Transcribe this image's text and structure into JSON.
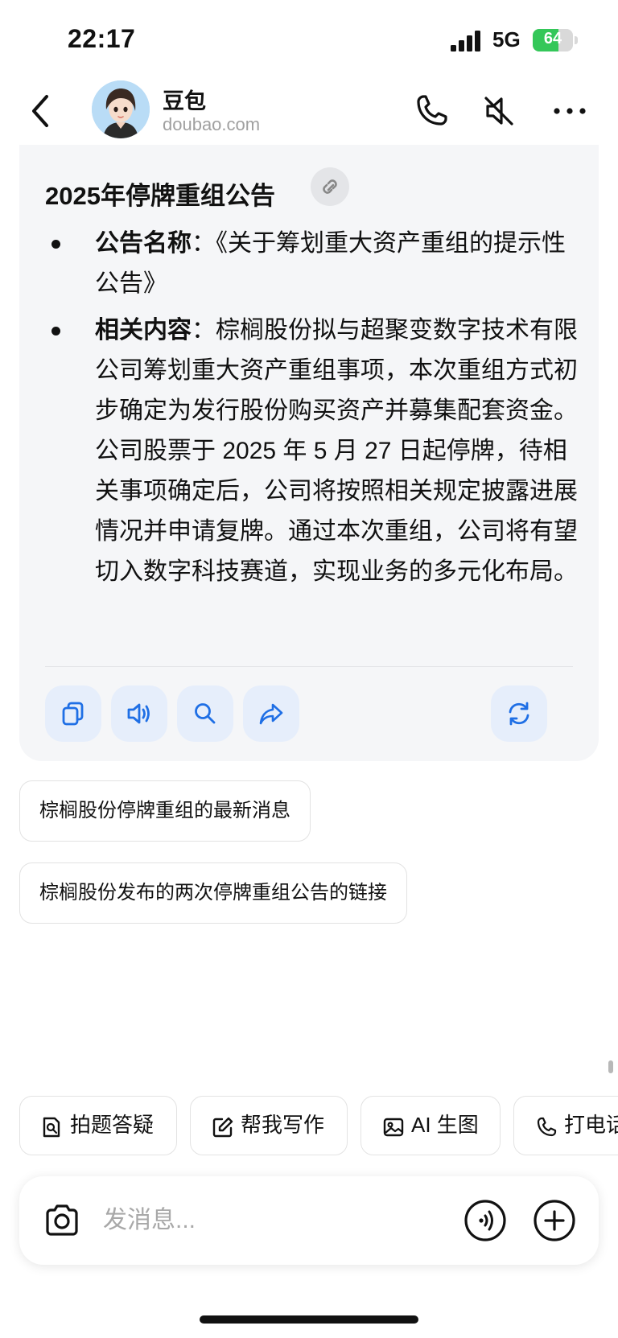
{
  "status_bar": {
    "time": "22:17",
    "network": "5G",
    "battery": "64",
    "battery_level": 0.64
  },
  "header": {
    "name": "豆包",
    "domain": "doubao.com"
  },
  "card": {
    "title": "2025年停牌重组公告",
    "items": [
      {
        "label": "公告名称",
        "separator": "：",
        "text": "《关于筹划重大资产重组的提示性公告》"
      },
      {
        "label": "相关内容",
        "separator": "：",
        "text": "棕榈股份拟与超聚变数字技术有限公司筹划重大资产重组事项，本次重组方式初步确定为发行股份购买资产并募集配套资金。公司股票于 2025 年 5 月 27 日起停牌，待相关事项确定后，公司将按照相关规定披露进展情况并申请复牌。通过本次重组，公司将有望切入数字科技赛道，实现业务的多元化布局。"
      }
    ]
  },
  "suggestions": [
    "棕榈股份停牌重组的最新消息",
    "棕榈股份发布的两次停牌重组公告的链接"
  ],
  "shortcuts": [
    {
      "label": "拍题答疑",
      "icon": "question-scan-icon"
    },
    {
      "label": "帮我写作",
      "icon": "edit-icon"
    },
    {
      "label": "AI 生图",
      "icon": "image-icon"
    },
    {
      "label": "打电话",
      "icon": "phone-icon"
    }
  ],
  "composer": {
    "placeholder": "发消息..."
  },
  "colors": {
    "accent": "#1f6fe5",
    "card_bg": "#f5f6f8",
    "battery": "#34c759"
  }
}
